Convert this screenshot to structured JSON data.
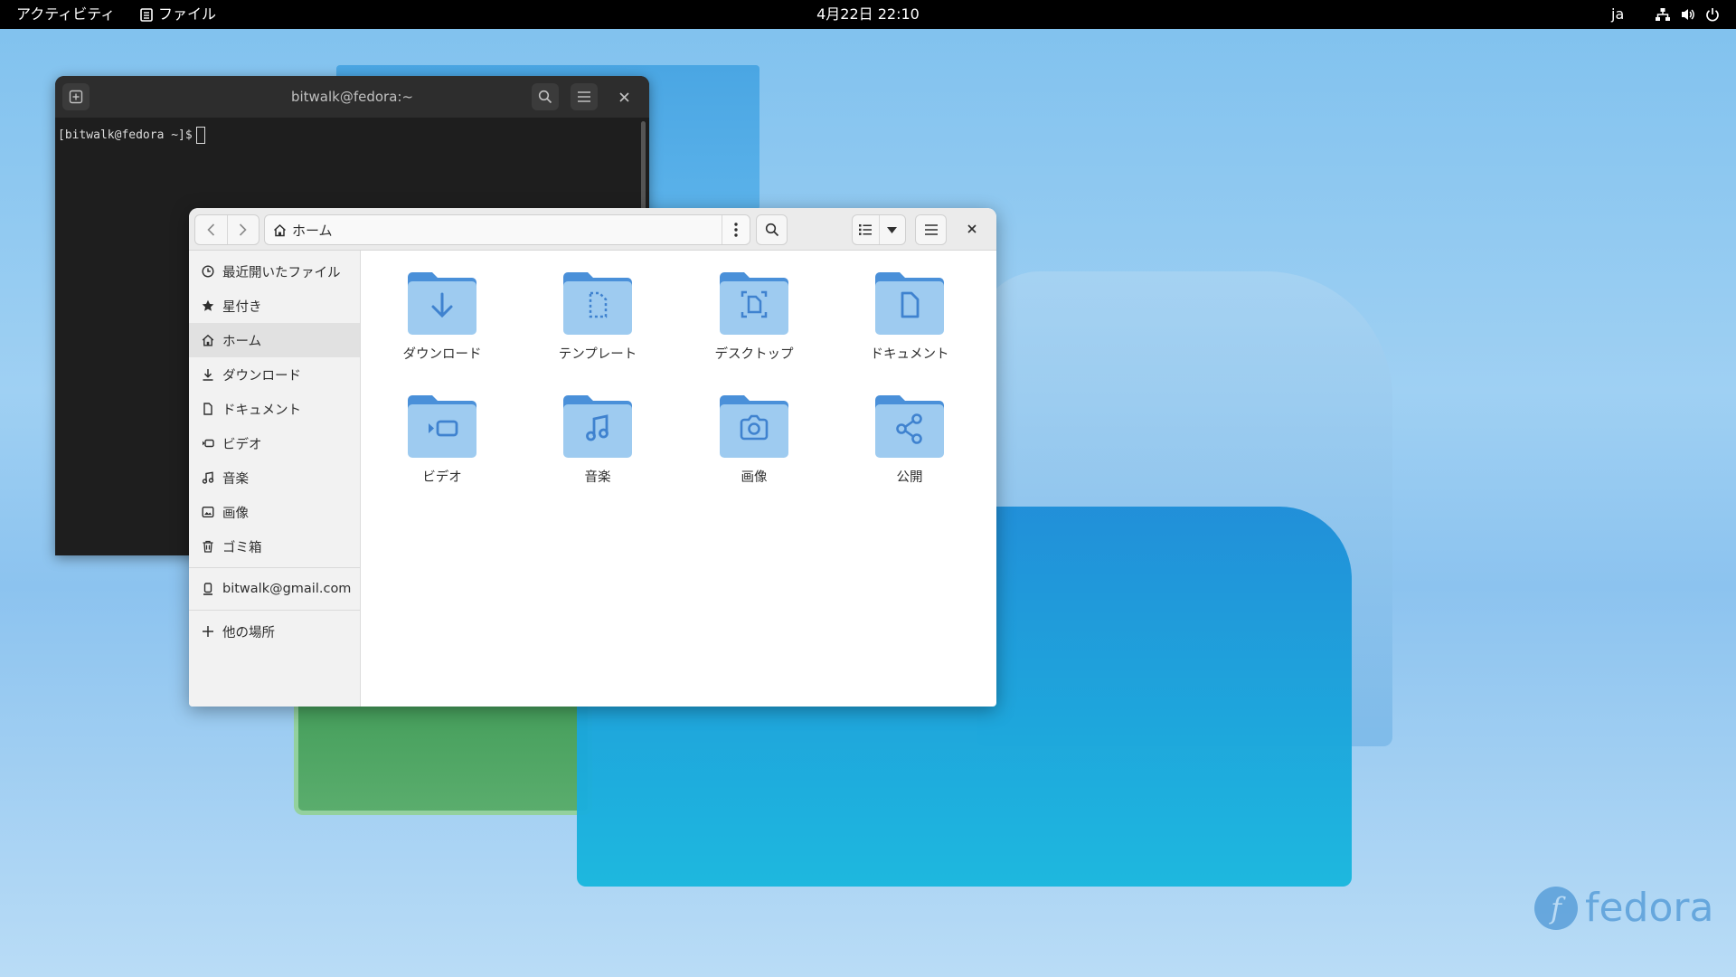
{
  "topbar": {
    "activities": "アクティビティ",
    "app_name": "ファイル",
    "clock": "4月22日 22:10",
    "language": "ja",
    "status_icons": [
      "network-icon",
      "volume-icon",
      "power-icon"
    ]
  },
  "terminal": {
    "title": "bitwalk@fedora:~",
    "prompt": "[bitwalk@fedora ~]$"
  },
  "files": {
    "path_label": "ホーム",
    "sidebar": [
      {
        "label": "最近開いたファイル",
        "icon": "clock-icon"
      },
      {
        "label": "星付き",
        "icon": "star-icon"
      },
      {
        "label": "ホーム",
        "icon": "home-icon",
        "active": true
      },
      {
        "label": "ダウンロード",
        "icon": "download-icon"
      },
      {
        "label": "ドキュメント",
        "icon": "document-icon"
      },
      {
        "label": "ビデオ",
        "icon": "video-icon"
      },
      {
        "label": "音楽",
        "icon": "music-icon"
      },
      {
        "label": "画像",
        "icon": "image-icon"
      },
      {
        "label": "ゴミ箱",
        "icon": "trash-icon"
      }
    ],
    "account": {
      "label": "bitwalk@gmail.com",
      "icon": "online-account-icon"
    },
    "other_locations": {
      "label": "他の場所",
      "icon": "plus-icon"
    },
    "folders": [
      {
        "label": "ダウンロード",
        "icon": "download-icon"
      },
      {
        "label": "テンプレート",
        "icon": "template-icon"
      },
      {
        "label": "デスクトップ",
        "icon": "desktop-icon"
      },
      {
        "label": "ドキュメント",
        "icon": "document-icon"
      },
      {
        "label": "ビデオ",
        "icon": "video-icon"
      },
      {
        "label": "音楽",
        "icon": "music-icon"
      },
      {
        "label": "画像",
        "icon": "camera-icon"
      },
      {
        "label": "公開",
        "icon": "share-icon"
      }
    ]
  },
  "wallpaper": {
    "logo_text": "fedora",
    "logo_letter": "f"
  },
  "colors": {
    "folder_back": "#4a90d9",
    "folder_front": "#9ecbf0",
    "folder_glyph": "#3f82cf"
  }
}
